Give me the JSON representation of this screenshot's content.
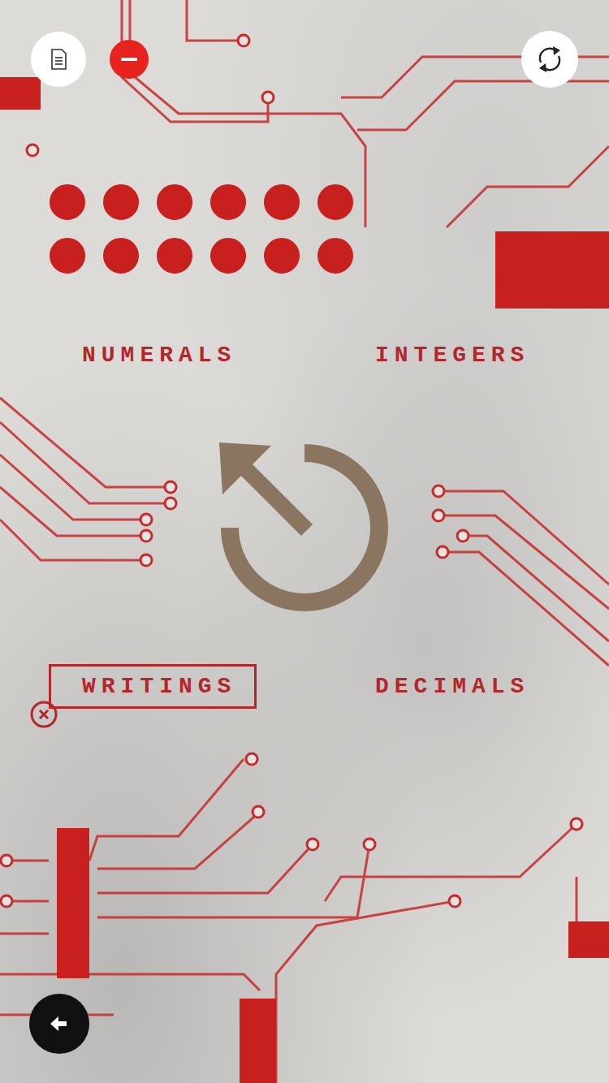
{
  "progress_dots": [
    {
      "filled": true
    },
    {
      "filled": true
    },
    {
      "filled": true
    },
    {
      "filled": true
    },
    {
      "filled": true
    },
    {
      "filled": true
    },
    {
      "filled": true
    },
    {
      "filled": true
    },
    {
      "filled": true
    },
    {
      "filled": true
    },
    {
      "filled": true
    },
    {
      "filled": true
    }
  ],
  "menu": [
    {
      "label": "NUMERALS",
      "selected": false
    },
    {
      "label": "INTEGERS",
      "selected": false
    },
    {
      "label": "WRITINGS",
      "selected": true
    },
    {
      "label": "DECIMALS",
      "selected": false
    }
  ]
}
